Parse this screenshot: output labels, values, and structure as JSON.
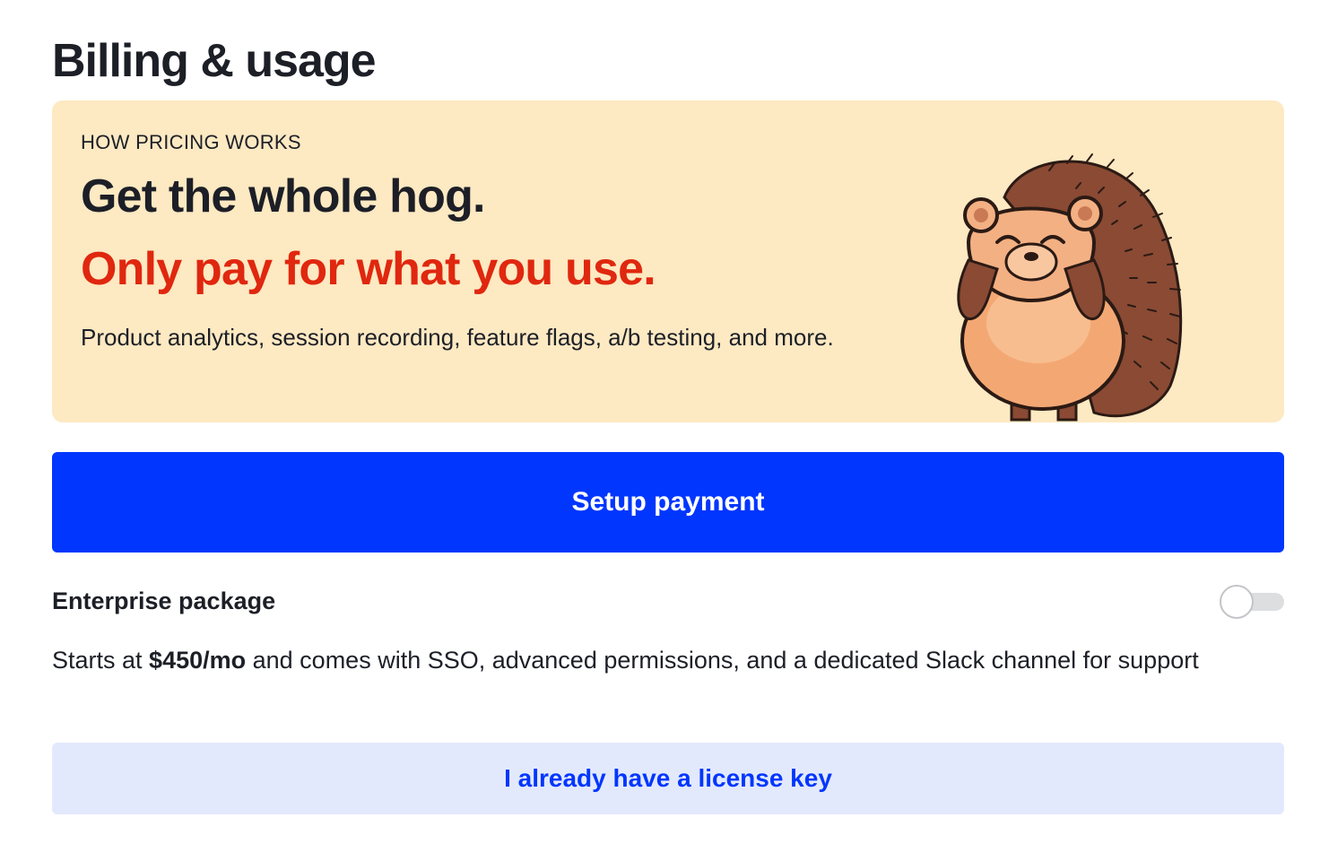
{
  "page": {
    "title": "Billing & usage"
  },
  "pricing_card": {
    "eyebrow": "HOW PRICING WORKS",
    "headline": "Get the whole hog.",
    "subheadline": "Only pay for what you use.",
    "description": "Product analytics, session recording, feature flags, a/b testing, and more.",
    "illustration": "hedgehog-illustration",
    "colors": {
      "background": "#fde9c2",
      "accent": "#e0270f"
    }
  },
  "setup_payment": {
    "label": "Setup payment",
    "color": "#0036fe"
  },
  "enterprise": {
    "title": "Enterprise package",
    "toggle_on": false,
    "desc_prefix": "Starts at ",
    "price": "$450/mo",
    "desc_suffix": " and comes with SSO, advanced permissions, and a dedicated Slack channel for support"
  },
  "license_key": {
    "label": "I already have a license key"
  }
}
